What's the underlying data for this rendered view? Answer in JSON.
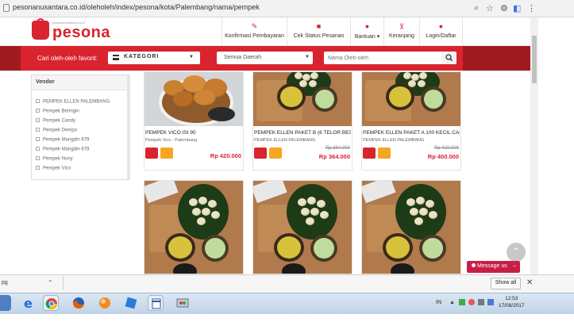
{
  "browser": {
    "url": "pesonanusantara.co.id/oleholeh/index/pesona/kota/Palembang/nama/pempek"
  },
  "header": {
    "logo_text": "pesona",
    "logo_tagline": "pesonanusantara.co.id",
    "nav": [
      {
        "label": "Konfirmasi Pembayaran",
        "icon": "edit-icon"
      },
      {
        "label": "Cek Status Pesanan",
        "icon": "truck-icon"
      },
      {
        "label": "Bantuan ▾",
        "icon": "help-icon"
      },
      {
        "label": "Keranjang",
        "icon": "cart-icon"
      },
      {
        "label": "Login/Daftar",
        "icon": "user-icon"
      }
    ]
  },
  "searchbar": {
    "favorite_label": "Cari oleh-oleh favorit:",
    "kategori_label": "KATEGORI",
    "daerah_value": "Semua Daerah",
    "search_placeholder": "Nama Oleh-oleh"
  },
  "sidebar": {
    "heading": "Vendor",
    "vendors": [
      "PEMPEK ELLEN PALEMBANG",
      "Pempek Beringin",
      "Pempek Candy",
      "Pempek Dempo",
      "Pempek Mangdin 679",
      "Pempek Mangdin 679",
      "Pempek Nony",
      "Pempek Vico"
    ]
  },
  "products": [
    {
      "name": "PEMPEK VICO ISI 90",
      "vendor": "Pempek Vico - Palembang",
      "old_price": "",
      "price": "Rp 420.000"
    },
    {
      "name": "PEMPEK ELLEN PAKET B (6 TELOR BESAR...",
      "vendor": "PEMPEK ELLEN PALEMBANG",
      "old_price": "Rp 384.000",
      "price": "Rp 364.000"
    },
    {
      "name": "PEMPEK ELLEN PAKET A 100 KECIL CAMP...",
      "vendor": "PEMPEK ELLEN PALEMBANG",
      "old_price": "Rp 420.000",
      "price": "Rp 400.000"
    }
  ],
  "message_button": "Message us",
  "download_bar": {
    "file_label": "pg",
    "show_all": "Show all"
  },
  "taskbar": {
    "lang": "IN",
    "time": "12:53",
    "date": "17/08/2017"
  },
  "colors": {
    "brand_red": "#d9232e",
    "dark_red": "#a01a22",
    "like_orange": "#f5a623"
  }
}
